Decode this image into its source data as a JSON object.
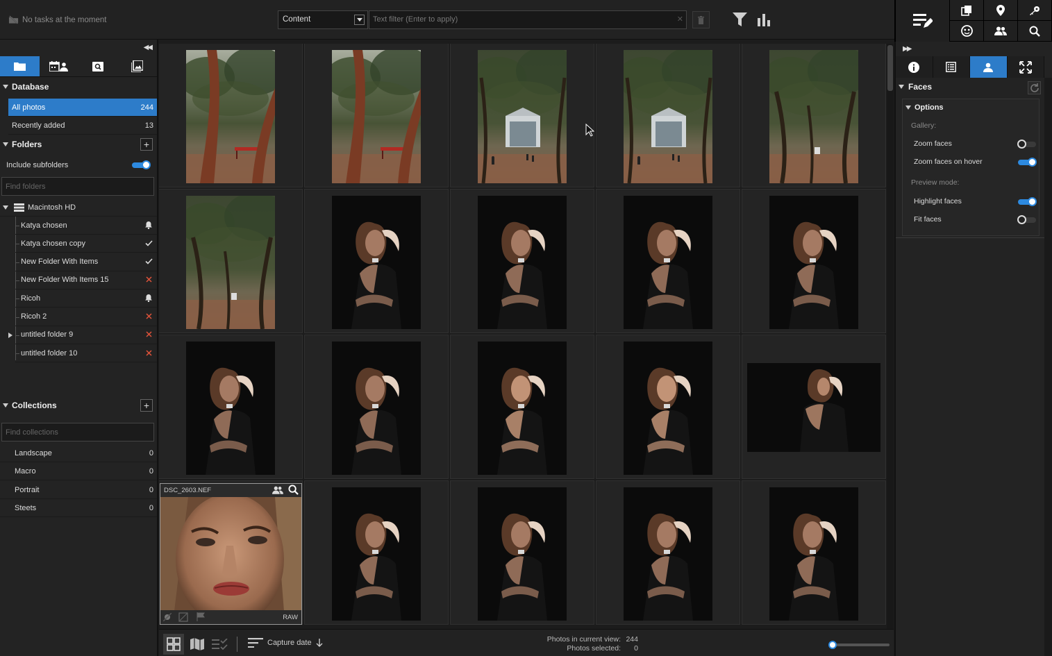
{
  "topbar": {
    "task_status": "No tasks at the moment",
    "content_select": "Content",
    "text_filter_placeholder": "Text filter (Enter to apply)"
  },
  "left": {
    "database": {
      "title": "Database",
      "items": [
        {
          "label": "All photos",
          "count": "244",
          "selected": true
        },
        {
          "label": "Recently added",
          "count": "13",
          "selected": false
        }
      ]
    },
    "folders": {
      "title": "Folders",
      "include_subfolders": "Include subfolders",
      "include_subfolders_on": true,
      "find_placeholder": "Find folders",
      "root": "Macintosh HD",
      "items": [
        {
          "label": "Katya chosen",
          "status": "bell"
        },
        {
          "label": "Katya chosen copy",
          "status": "check"
        },
        {
          "label": "New Folder With Items",
          "status": "check"
        },
        {
          "label": "New Folder With Items 15",
          "status": "cross"
        },
        {
          "label": "Ricoh",
          "status": "bell"
        },
        {
          "label": "Ricoh 2",
          "status": "cross"
        },
        {
          "label": "untitled folder 9",
          "status": "cross",
          "expandable": true
        },
        {
          "label": "untitled folder 10",
          "status": "cross"
        }
      ]
    },
    "collections": {
      "title": "Collections",
      "find_placeholder": "Find collections",
      "items": [
        {
          "label": "Landscape",
          "count": "0"
        },
        {
          "label": "Macro",
          "count": "0"
        },
        {
          "label": "Portrait",
          "count": "0"
        },
        {
          "label": "Steets",
          "count": "0"
        }
      ]
    }
  },
  "gallery": {
    "photo_kinds": [
      [
        "park-bench",
        "park-bench",
        "park-building",
        "park-building",
        "park-trees"
      ],
      [
        "park-trees",
        "portrait-dark",
        "portrait-dark",
        "portrait-dark",
        "portrait-dark"
      ],
      [
        "portrait-dark",
        "portrait-dark",
        "portrait-light",
        "portrait-light",
        "portrait-wide"
      ],
      [
        "closeup-face",
        "portrait-dark",
        "portrait-dark",
        "portrait-dark",
        "portrait-dark"
      ]
    ],
    "hovered": {
      "filename": "DSC_2603.NEF",
      "format": "RAW"
    }
  },
  "bottombar": {
    "sort_label": "Capture date",
    "photos_in_view_label": "Photos in current view:",
    "photos_in_view": "244",
    "photos_selected_label": "Photos selected:",
    "photos_selected": "0",
    "zoom_level": 0.05
  },
  "right": {
    "faces_title": "Faces",
    "options_title": "Options",
    "gallery_label": "Gallery:",
    "zoom_faces": "Zoom faces",
    "zoom_faces_on": false,
    "zoom_faces_hover": "Zoom faces on hover",
    "zoom_faces_hover_on": true,
    "preview_mode_label": "Preview mode:",
    "highlight_faces": "Highlight faces",
    "highlight_faces_on": true,
    "fit_faces": "Fit faces",
    "fit_faces_on": false
  },
  "colors": {
    "accent": "#2d7cc9",
    "status_cross": "#e0533a",
    "background": "#1c1c1c"
  }
}
